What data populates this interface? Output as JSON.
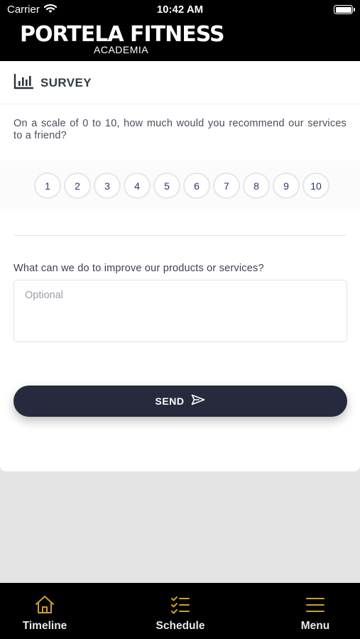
{
  "status_bar": {
    "carrier": "Carrier",
    "time": "10:42 AM",
    "icons": [
      "wifi-icon",
      "battery-icon"
    ]
  },
  "brand": {
    "title": "PORTELA FITNESS",
    "subtitle": "ACADEMIA"
  },
  "survey": {
    "header_icon": "bar-chart-icon",
    "header_title": "SURVEY",
    "question1": "On a scale of 0 to 10, how much would you recommend our services to a friend?",
    "scale": [
      "1",
      "2",
      "3",
      "4",
      "5",
      "6",
      "7",
      "8",
      "9",
      "10"
    ],
    "question2": "What can we do to improve our products or services?",
    "feedback_value": "",
    "feedback_placeholder": "Optional",
    "send_label": "SEND",
    "send_icon": "paper-plane-icon"
  },
  "tab_bar": {
    "items": [
      {
        "label": "Timeline",
        "icon": "home-icon"
      },
      {
        "label": "Schedule",
        "icon": "checklist-icon"
      },
      {
        "label": "Menu",
        "icon": "hamburger-icon"
      }
    ]
  },
  "colors": {
    "accent": "#c9a227",
    "header_bg": "#000000",
    "button_bg": "#272a3c",
    "scale_text": "#2b3470",
    "page_bg": "#e4e4e4"
  }
}
